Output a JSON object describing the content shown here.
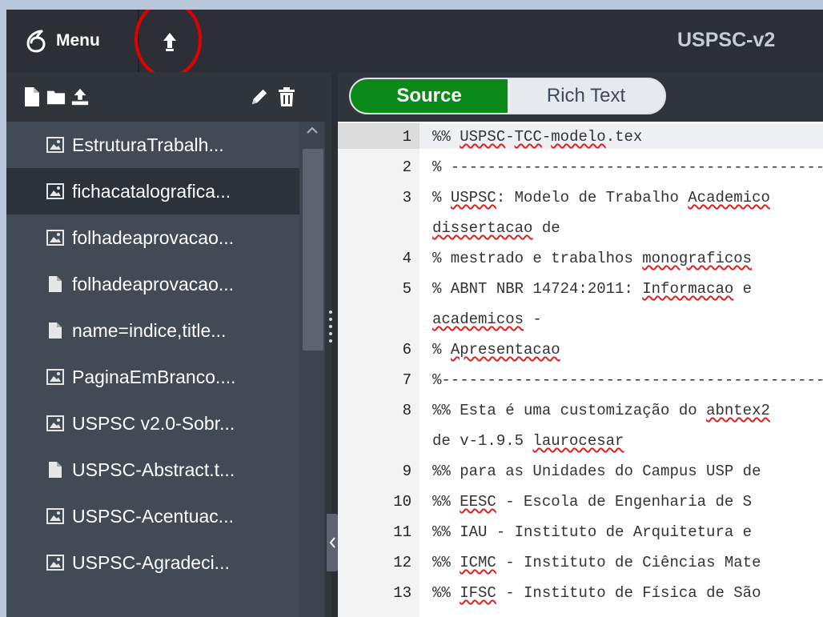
{
  "topbar": {
    "menu_label": "Menu",
    "project_title": "USPSC-v2"
  },
  "sidebar": {
    "toolbar_icons": [
      "new-file-icon",
      "new-folder-icon",
      "upload-icon",
      "pencil-icon",
      "trash-icon"
    ],
    "files": [
      {
        "name": "EstruturaTrabalh...",
        "icon": "image-icon"
      },
      {
        "name": "fichacatalografica...",
        "icon": "image-icon",
        "selected": true
      },
      {
        "name": "folhadeaprovacao...",
        "icon": "image-icon"
      },
      {
        "name": "folhadeaprovacao...",
        "icon": "file-icon"
      },
      {
        "name": "name=indice,title...",
        "icon": "file-icon"
      },
      {
        "name": "PaginaEmBranco....",
        "icon": "image-icon"
      },
      {
        "name": "USPSC v2.0-Sobr...",
        "icon": "image-icon"
      },
      {
        "name": "USPSC-Abstract.t...",
        "icon": "file-icon"
      },
      {
        "name": "USPSC-Acentuac...",
        "icon": "image-icon"
      },
      {
        "name": "USPSC-Agradeci...",
        "icon": "image-icon"
      }
    ]
  },
  "editor": {
    "mode_source": "Source",
    "mode_rich": "Rich Text",
    "active_mode": "Source",
    "lines": [
      {
        "num": "1",
        "text": "%% USPSC-TCC-modelo.tex"
      },
      {
        "num": "2",
        "text": "% ---------------------------------------------"
      },
      {
        "num": "3",
        "text": "% USPSC: Modelo de Trabalho Academico"
      },
      {
        "num": "",
        "text": "dissertacao de"
      },
      {
        "num": "4",
        "text": "% mestrado e trabalhos monograficos"
      },
      {
        "num": "5",
        "text": "% ABNT NBR 14724:2011: Informacao e"
      },
      {
        "num": "",
        "text": "academicos -"
      },
      {
        "num": "6",
        "text": "% Apresentacao"
      },
      {
        "num": "7",
        "text": "%---------------------------------------------"
      },
      {
        "num": "8",
        "text": "%% Esta é uma customização do abntex2"
      },
      {
        "num": "",
        "text": "de v-1.9.5 laurocesar"
      },
      {
        "num": "9",
        "text": "%% para as Unidades do Campus USP de"
      },
      {
        "num": "10",
        "text": "%% EESC - Escola de Engenharia de S"
      },
      {
        "num": "11",
        "text": "%% IAU - Instituto de Arquitetura e"
      },
      {
        "num": "12",
        "text": "%% ICMC - Instituto de Ciências Mate"
      },
      {
        "num": "13",
        "text": "%% IFSC - Instituto de Física de São"
      }
    ]
  },
  "annotation": {
    "color": "#e00000",
    "target": "upload-button"
  },
  "colors": {
    "accent_green": "#0b8a19",
    "sidebar_bg": "#414a55",
    "topbar_bg": "#2c3036"
  }
}
